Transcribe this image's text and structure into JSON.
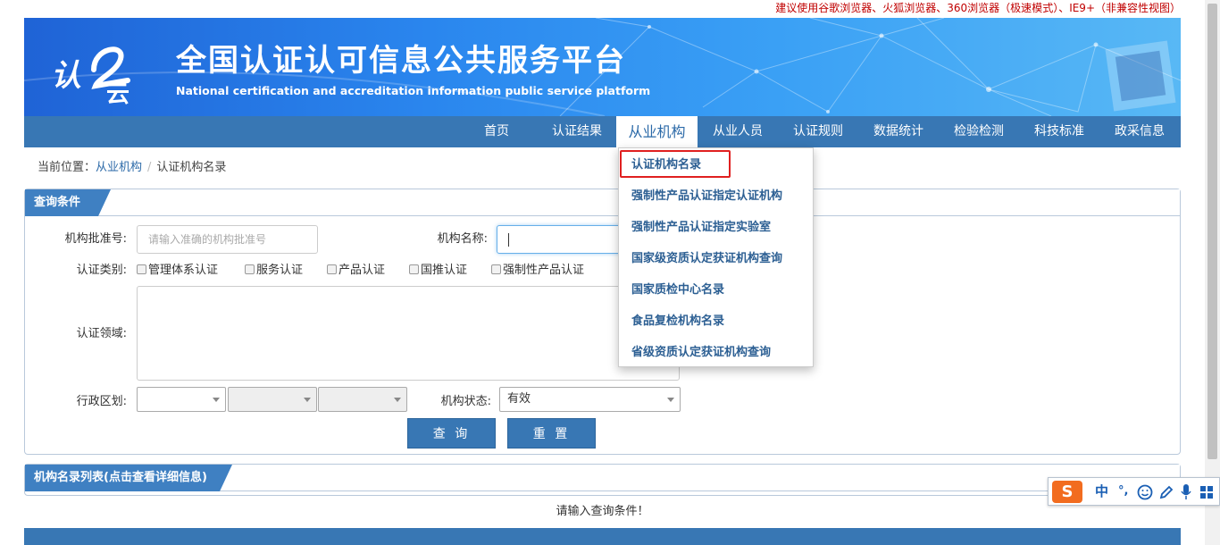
{
  "notice": "建议使用谷歌浏览器、火狐浏览器、360浏览器（极速模式）、IE9+（非兼容性视图）",
  "header": {
    "logo_text": "认证云",
    "title": "全国认证认可信息公共服务平台",
    "subtitle": "National certification and accreditation information public service platform"
  },
  "nav": {
    "items": [
      {
        "label": "首页"
      },
      {
        "label": "认证结果"
      },
      {
        "label": "从业机构"
      },
      {
        "label": "从业人员"
      },
      {
        "label": "认证规则"
      },
      {
        "label": "数据统计"
      },
      {
        "label": "检验检测"
      },
      {
        "label": "科技标准"
      },
      {
        "label": "政采信息"
      }
    ],
    "active": "从业机构"
  },
  "breadcrumb": {
    "prefix": "当前位置：",
    "section": "从业机构",
    "separator": "/",
    "current": "认证机构名录"
  },
  "query_panel": {
    "title": "查询条件",
    "approval_no_label": "机构批准号:",
    "approval_no_placeholder": "请输入准确的机构批准号",
    "org_name_label": "机构名称:",
    "org_name_value": "",
    "cert_type_label": "认证类别:",
    "cert_types": [
      {
        "label": "管理体系认证",
        "checked": false
      },
      {
        "label": "服务认证",
        "checked": false
      },
      {
        "label": "产品认证",
        "checked": false
      },
      {
        "label": "国推认证",
        "checked": false
      },
      {
        "label": "强制性产品认证",
        "checked": false
      }
    ],
    "cert_field_label": "认证领域:",
    "region_label": "行政区划:",
    "region_values": [
      "",
      "",
      ""
    ],
    "status_label": "机构状态:",
    "status_value": "有效",
    "search_button": "查 询",
    "reset_button": "重 置"
  },
  "result_panel": {
    "title": "机构名录列表(点击查看详细信息)",
    "hint": "请输入查询条件！"
  },
  "dropdown": {
    "items": [
      {
        "label": "认证机构名录"
      },
      {
        "label": "强制性产品认证指定认证机构"
      },
      {
        "label": "强制性产品认证指定实验室"
      },
      {
        "label": "国家级资质认定获证机构查询"
      },
      {
        "label": "国家质检中心名录"
      },
      {
        "label": "食品复检机构名录"
      },
      {
        "label": "省级资质认定获证机构查询"
      }
    ],
    "highlighted": "认证机构名录"
  },
  "ime": {
    "logo": "S",
    "mode": "中",
    "punct": "°,",
    "icons": [
      "smiley-icon",
      "pen-icon",
      "mic-icon",
      "grid-icon"
    ]
  },
  "colors": {
    "nav_bg": "#3877b4",
    "link": "#2c6aa8",
    "notice": "#c00000",
    "highlight_border": "#e02020"
  }
}
